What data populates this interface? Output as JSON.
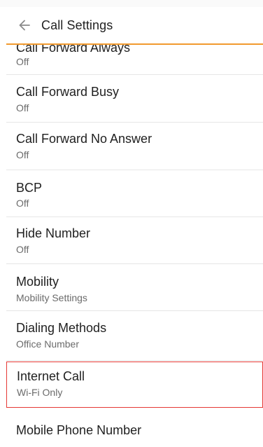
{
  "header": {
    "title": "Call Settings",
    "back_icon": "arrow-left-icon"
  },
  "colors": {
    "accent": "#f29a2e",
    "highlight": "#e53935"
  },
  "settings": [
    {
      "title": "Call Forward Always",
      "value": "Off"
    },
    {
      "title": "Call Forward Busy",
      "value": "Off"
    },
    {
      "title": "Call Forward No Answer",
      "value": "Off"
    },
    {
      "title": "BCP",
      "value": "Off"
    },
    {
      "title": "Hide Number",
      "value": "Off"
    },
    {
      "title": "Mobility",
      "value": "Mobility Settings"
    },
    {
      "title": "Dialing Methods",
      "value": "Office Number"
    },
    {
      "title": "Internet Call",
      "value": "Wi-Fi Only"
    },
    {
      "title": "Mobile Phone Number",
      "value": ""
    }
  ]
}
